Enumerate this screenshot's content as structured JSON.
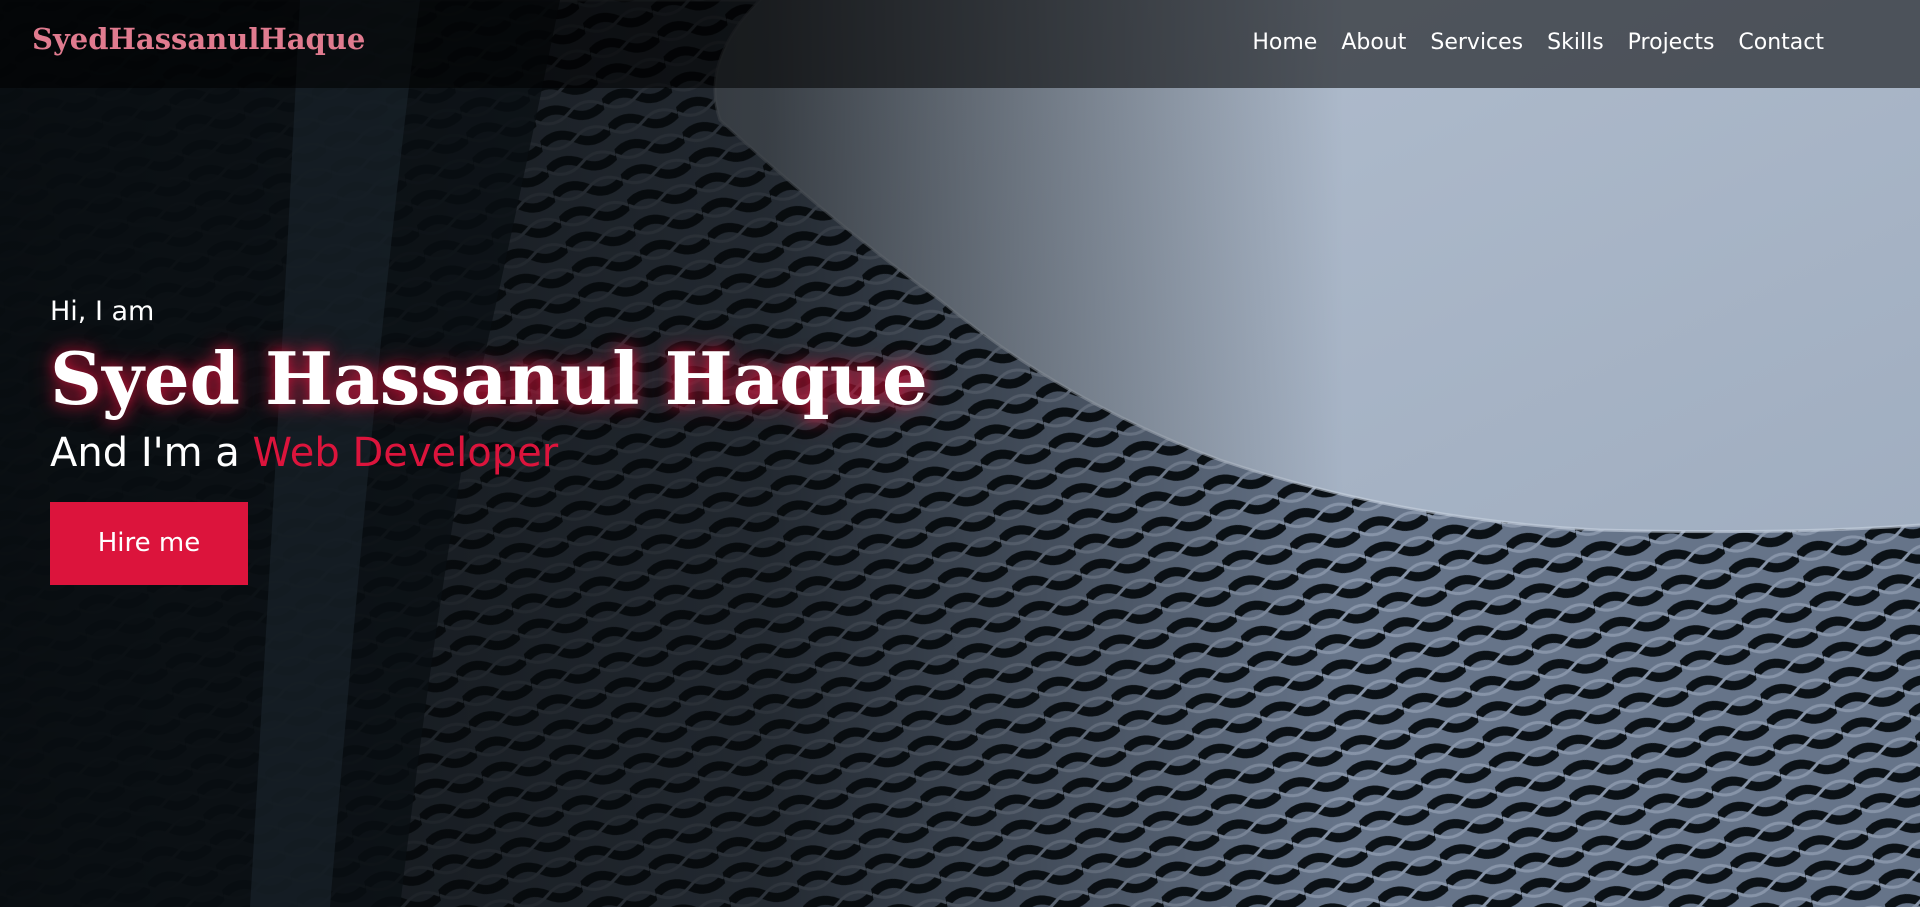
{
  "brand": {
    "logo_text": "SyedHassanulHaque",
    "logo_color": "#e07b8f"
  },
  "nav": {
    "items": [
      {
        "label": "Home"
      },
      {
        "label": "About"
      },
      {
        "label": "Services"
      },
      {
        "label": "Skills"
      },
      {
        "label": "Projects"
      },
      {
        "label": "Contact"
      }
    ]
  },
  "hero": {
    "greeting": "Hi, I am",
    "name": "Syed Hassanul Haque",
    "role_prefix": "And I'm a",
    "role": "Web Developer",
    "cta_label": "Hire me"
  },
  "colors": {
    "accent": "#dc143c",
    "sky": "#aab6c8",
    "dark": "#0c1216"
  }
}
